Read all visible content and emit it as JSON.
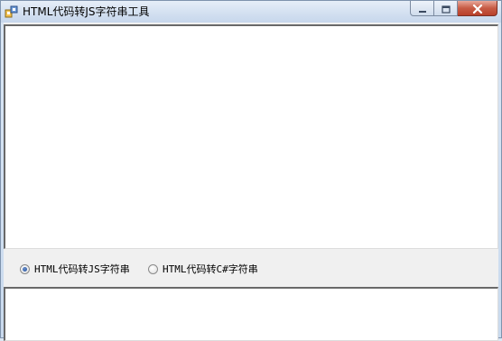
{
  "window": {
    "title": "HTML代码转JS字符串工具",
    "controls": {
      "minimize": "minimize-icon",
      "maximize": "maximize-icon",
      "close": "close-icon"
    }
  },
  "input_box": {
    "value": ""
  },
  "options": [
    {
      "label": "HTML代码转JS字符串",
      "checked": true
    },
    {
      "label": "HTML代码转C#字符串",
      "checked": false
    }
  ],
  "output_box": {
    "value": ""
  },
  "colors": {
    "title_bar": "#d2dff0",
    "close_button": "#c75b45",
    "client_background": "#f0f0f0",
    "radio_selected": "#1f4f9e"
  }
}
